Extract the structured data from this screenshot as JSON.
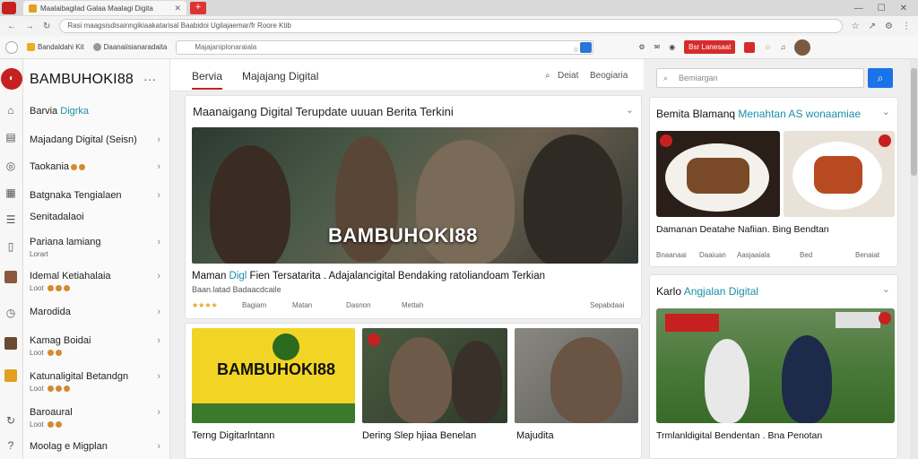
{
  "browser": {
    "tab_title": "Maalaibagilad Galaa Maalagi Digita",
    "url": "Rasi maagsisdisainngikiaakatarisal Baabidoi Ugilajaemar/fr Roore Ktib",
    "bookmarks": [
      "Bandaldahi Kit",
      "Daanaiisianaradaita"
    ],
    "bookmark_search": "Majajaniplonaraiala",
    "red_button": "Bsr Lanesaat"
  },
  "sidebar": {
    "brand": "BAMBUHOKI88",
    "more": "···",
    "items": [
      {
        "label": "Barvia ",
        "highlight": "Digrka",
        "sub": ""
      },
      {
        "label": "Majadang Digital (Seisn)",
        "sub": ""
      },
      {
        "label": "Taokania",
        "sub": ""
      },
      {
        "label": "Batgnaka Tengialaen",
        "sub": ""
      },
      {
        "label": "Senitadalaoi",
        "sub": ""
      },
      {
        "label": "Pariana lamiang",
        "sub": "Lorart"
      },
      {
        "label": "Idemal Ketiahalaia",
        "sub": "Loot"
      },
      {
        "label": "Marodida",
        "sub": ""
      },
      {
        "label": "Kamag Boidai",
        "sub": "Loot"
      },
      {
        "label": "Katunaligital Betandgn",
        "sub": "Loot"
      },
      {
        "label": "Baroaural",
        "sub": "Loot"
      },
      {
        "label": "Moolag e Migplan",
        "sub": ""
      }
    ]
  },
  "nav": {
    "tabs": [
      "Bervia",
      "Majajang Digital"
    ],
    "right": [
      "Deiat",
      "Beogiaria"
    ]
  },
  "feature": {
    "title": "Maanaigang Digital Terupdate uuuan Berita Terkini",
    "overlay": "BAMBUHOKI88",
    "caption_a": "Maman ",
    "caption_hl": "Digl",
    "caption_b": " Fien Tersatarita . Adajalancigital Bendaking ratoliandoam Terkian",
    "sub": "Baan.latad  Badaacdcaile",
    "meta": [
      "Bagiam",
      "Matan",
      "Dasnon",
      "Mettah",
      "Sepabdaai"
    ]
  },
  "thumbs": [
    {
      "overlay": "BAMBUHOKI88",
      "caption": "Terng Digitarlntann"
    },
    {
      "overlay": "",
      "caption": "Dering Slep hjiaa Benelan"
    },
    {
      "overlay": "",
      "caption": "Majudita"
    }
  ],
  "right": {
    "search_placeholder": "Bemiargan",
    "section1_title_a": "Bemita Blamanq ",
    "section1_title_hl": "Menahtan AS wonaamiae",
    "section1_caption": "Damanan Deatahe Nafiian. Bing Bendtan",
    "section1_meta": [
      "Bnaanaai",
      "Daaiuan",
      "Aasjaaiala",
      "Bed",
      "Benaiat"
    ],
    "section2_title_a": "Karlo ",
    "section2_title_hl": "Angjalan Digital",
    "section2_caption": "Trmlanldigital Bendentan . Bna Penotan"
  },
  "colors": {
    "accent": "#c72020",
    "link": "#1a8fa8",
    "button": "#1a73e8"
  }
}
